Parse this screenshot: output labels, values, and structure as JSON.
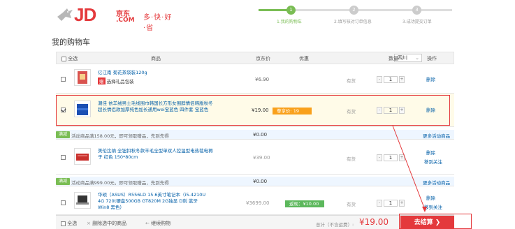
{
  "header": {
    "logo_text": "JD",
    "logo_cn": "京东",
    "logo_com": ".COM",
    "slogan": "多·快·好·省",
    "steps": [
      {
        "num": "1",
        "label": "1.我的购物车"
      },
      {
        "num": "2",
        "label": "2.填写核对订单信息"
      },
      {
        "num": "3",
        "label": "3.成功提交订单"
      }
    ]
  },
  "title": "我的购物车",
  "thead": {
    "select_all": "全选",
    "product": "商品",
    "price": "京东价",
    "discount": "优惠",
    "filter_value": "四川",
    "qty": "数量",
    "op": "操作"
  },
  "items": [
    {
      "name": "亿江南 菊花茶袋装120g",
      "sub": "选择礼品包装",
      "price": "¥6.90",
      "discount": "有货",
      "qty": "1",
      "ops": [
        "删除"
      ]
    },
    {
      "name": "潮佳 依羊绒男士毛线围巾韩国长方形女围脖情侣韩版秋冬超长情侣款加厚纯色加长通用wei宝蓝色 四件套 宝蓝色",
      "price": "¥19.00",
      "promo": "尊享价: 19",
      "discount": "有货",
      "qty": "1",
      "ops": [
        "删除"
      ]
    },
    {
      "name": "美伦比纳 全钮扣秋冬款羊毛全型单双人控温型电热毯电褥子 红色 150*80cm",
      "price": "¥39.00",
      "discount": "有货",
      "qty": "1",
      "ops": [
        "删除",
        "移到关注"
      ]
    },
    {
      "name": "华硕（ASUS）R556LD 15.6英寸笔记本（i5-4210U 4G 720t硬盘500GB GT820M 2G独显 D刻 蓝牙 Win8 黑色）",
      "price": "¥3699.00",
      "promo": "返现：¥10.00",
      "discount": "有货",
      "qty": "1",
      "ops": [
        "删除",
        "移到关注"
      ]
    }
  ],
  "promos": [
    {
      "badge": "满减",
      "text": "活动商品满158.00元，即可领取赠品，先到先得",
      "value": "¥0.00",
      "more": "更多活动商品"
    },
    {
      "badge": "满减",
      "text": "活动商品满999.00元，即可领取赠品，先到先得",
      "value": "¥0.00",
      "more": "更多活动商品"
    }
  ],
  "footer": {
    "select_all": "全选",
    "delete_selected": "删除选中的商品",
    "continue": "继续购物",
    "total_label": "总计（不含运费）:",
    "total": "¥19.00",
    "checkout": "去结算 ❯"
  },
  "colors": {
    "brand": "#e4393c",
    "step_done": "#7abd54",
    "link": "#005ea7"
  }
}
